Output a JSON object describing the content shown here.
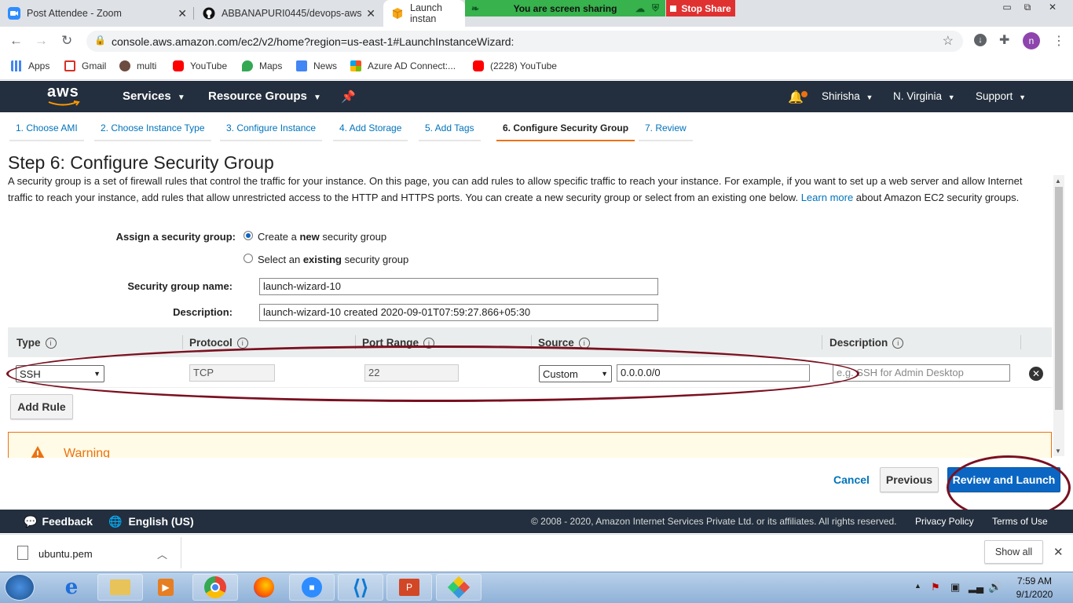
{
  "browser": {
    "tabs": [
      {
        "title": "Post Attendee - Zoom"
      },
      {
        "title": "ABBANAPURI0445/devops-aws"
      },
      {
        "title": "Launch instan"
      }
    ],
    "screen_share": {
      "status": "You are screen sharing",
      "stop_label": "Stop Share"
    },
    "url": "console.aws.amazon.com/ec2/v2/home?region=us-east-1#LaunchInstanceWizard:",
    "profile_initial": "n",
    "bookmarks": [
      "Apps",
      "Gmail",
      "multi",
      "YouTube",
      "Maps",
      "News",
      "Azure AD Connect:...",
      "(2228) YouTube"
    ]
  },
  "aws_nav": {
    "logo": "aws",
    "services": "Services",
    "resource_groups": "Resource Groups",
    "user": "Shirisha",
    "region": "N. Virginia",
    "support": "Support"
  },
  "wizard": {
    "steps": [
      "1. Choose AMI",
      "2. Choose Instance Type",
      "3. Configure Instance",
      "4. Add Storage",
      "5. Add Tags",
      "6. Configure Security Group",
      "7. Review"
    ],
    "current_step": 6,
    "title": "Step 6: Configure Security Group",
    "intro_1": "A security group is a set of firewall rules that control the traffic for your instance. On this page, you can add rules to allow specific traffic to reach your instance. For example, if you want to set up a web server and allow Internet traffic to reach your instance, add rules that allow unrestricted access to the HTTP and HTTPS ports. You can create a new security group or select from an existing one below. ",
    "learn_more": "Learn more",
    "intro_2": " about Amazon EC2 security groups.",
    "assign_label": "Assign a security group:",
    "option_new_pre": "Create a ",
    "option_new_bold": "new",
    "option_new_post": " security group",
    "option_existing_pre": "Select an ",
    "option_existing_bold": "existing",
    "option_existing_post": " security group",
    "selected_option": "new",
    "sg_name_label": "Security group name:",
    "sg_name_value": "launch-wizard-10",
    "desc_label": "Description:",
    "desc_value": "launch-wizard-10 created 2020-09-01T07:59:27.866+05:30",
    "table": {
      "headers": [
        "Type",
        "Protocol",
        "Port Range",
        "Source",
        "Description"
      ],
      "rows": [
        {
          "type": "SSH",
          "protocol": "TCP",
          "port_range": "22",
          "source_mode": "Custom",
          "source_cidr": "0.0.0.0/0",
          "description_placeholder": "e.g. SSH for Admin Desktop"
        }
      ]
    },
    "add_rule": "Add Rule",
    "warning_title": "Warning",
    "cancel": "Cancel",
    "previous": "Previous",
    "review_launch": "Review and Launch"
  },
  "footer": {
    "feedback": "Feedback",
    "language": "English (US)",
    "copyright": "© 2008 - 2020, Amazon Internet Services Private Ltd. or its affiliates. All rights reserved.",
    "privacy": "Privacy Policy",
    "terms": "Terms of Use"
  },
  "downloads": {
    "file": "ubuntu.pem",
    "show_all": "Show all"
  },
  "taskbar": {
    "time": "7:59 AM",
    "date": "9/1/2020"
  },
  "colors": {
    "aws_dark": "#232f3e",
    "accent_orange": "#ec7211",
    "link_blue": "#0073bb",
    "primary_button": "#0a66c2",
    "annotation_ellipse": "#7a1020"
  }
}
